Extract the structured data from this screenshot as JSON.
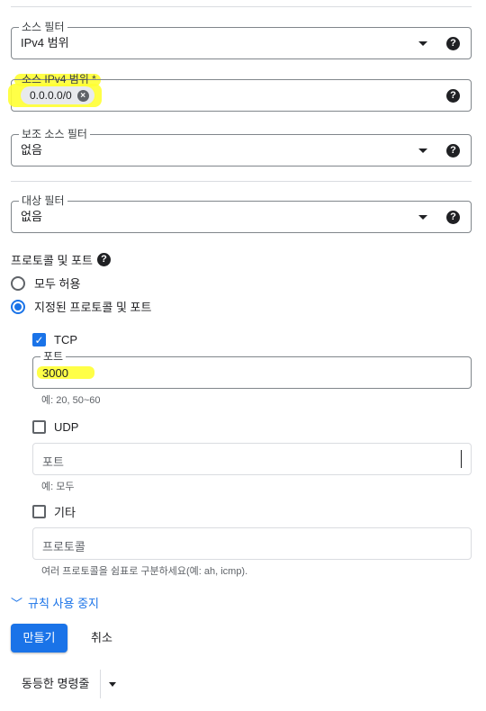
{
  "source_filter": {
    "label": "소스 필터",
    "value": "IPv4 범위"
  },
  "source_range": {
    "label": "소스 IPv4 범위 *",
    "chip": "0.0.0.0/0"
  },
  "secondary_filter": {
    "label": "보조 소스 필터",
    "value": "없음"
  },
  "target_filter": {
    "label": "대상 필터",
    "value": "없음"
  },
  "protocols": {
    "title": "프로토콜 및 포트",
    "allow_all": "모두 허용",
    "specified": "지정된 프로토콜 및 포트",
    "tcp": {
      "label": "TCP",
      "checked": true,
      "port_label": "포트",
      "port_value": "3000",
      "hint": "예: 20, 50~60"
    },
    "udp": {
      "label": "UDP",
      "checked": false,
      "port_placeholder": "포트",
      "hint": "예: 모두"
    },
    "other": {
      "label": "기타",
      "checked": false,
      "placeholder": "프로토콜",
      "hint": "여러 프로토콜을 쉼표로 구분하세요(예: ah, icmp)."
    }
  },
  "toggle_rule": "규칙 사용 중지",
  "actions": {
    "create": "만들기",
    "cancel": "취소",
    "equivalent": "동등한 명령줄"
  },
  "icons": {
    "help": "?",
    "check": "✓",
    "chip_remove": "×",
    "chevron": "﹀"
  },
  "colors": {
    "accent": "#1a73e8",
    "highlight": "#ffff33"
  }
}
